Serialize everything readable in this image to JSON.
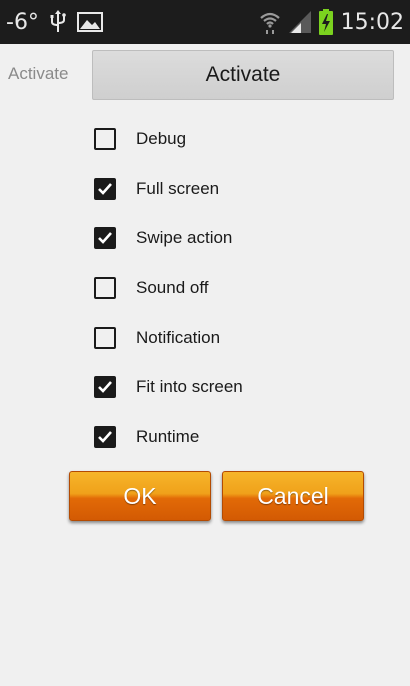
{
  "status_bar": {
    "temperature": "-6°",
    "time": "15:02",
    "icons": [
      "usb-icon",
      "image-icon",
      "wifi-icon",
      "signal-icon",
      "battery-charging-icon"
    ]
  },
  "activate": {
    "label": "Activate",
    "button_label": "Activate"
  },
  "options": [
    {
      "label": "Debug",
      "checked": false
    },
    {
      "label": "Full screen",
      "checked": true
    },
    {
      "label": "Swipe action",
      "checked": true
    },
    {
      "label": "Sound off",
      "checked": false
    },
    {
      "label": "Notification",
      "checked": false
    },
    {
      "label": "Fit into screen",
      "checked": true
    },
    {
      "label": "Runtime",
      "checked": true
    }
  ],
  "buttons": {
    "ok_label": "OK",
    "cancel_label": "Cancel"
  },
  "colors": {
    "accent_orange": "#e8800f",
    "status_bar": "#1c1c1c",
    "background": "#f0f0f0",
    "battery_green": "#7bd21f"
  }
}
